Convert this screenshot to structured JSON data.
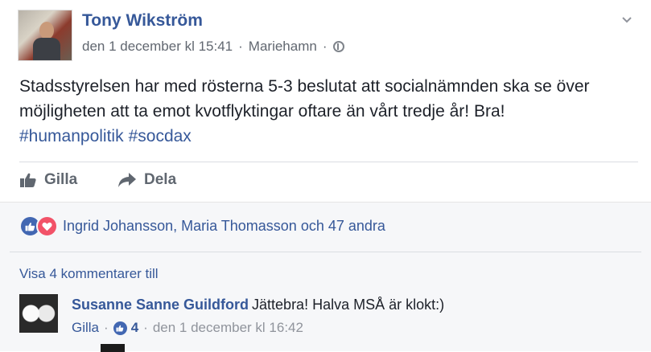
{
  "post": {
    "author": "Tony Wikström",
    "date": "den 1 december kl 15:41",
    "location": "Mariehamn",
    "separator": "·",
    "body": "Stadsstyrelsen har med rösterna 5-3 beslutat att socialnämnden ska se över möjligheten att ta emot kvotflyktingar oftare än vårt tredje år! Bra!",
    "hashtags": [
      "#humanpolitik",
      "#socdax"
    ],
    "icons": {
      "privacy": "globe-icon",
      "menu": "chevron-down-icon"
    }
  },
  "actions": {
    "like_label": "Gilla",
    "share_label": "Dela"
  },
  "reactions": {
    "summary": "Ingrid Johansson, Maria Thomasson och 47 andra",
    "types": [
      "like",
      "love"
    ]
  },
  "comments": {
    "view_more": "Visa 4 kommentarer till",
    "items": [
      {
        "author": "Susanne Sanne Guildford",
        "text": "Jättebra! Halva MSÅ är klokt:)",
        "like_label": "Gilla",
        "like_count": "4",
        "time": "den 1 december kl 16:42"
      }
    ]
  },
  "colors": {
    "link": "#365899",
    "meta": "#616770",
    "like": "#4267b2",
    "love": "#f25268",
    "comments_bg": "#f6f7f9"
  }
}
